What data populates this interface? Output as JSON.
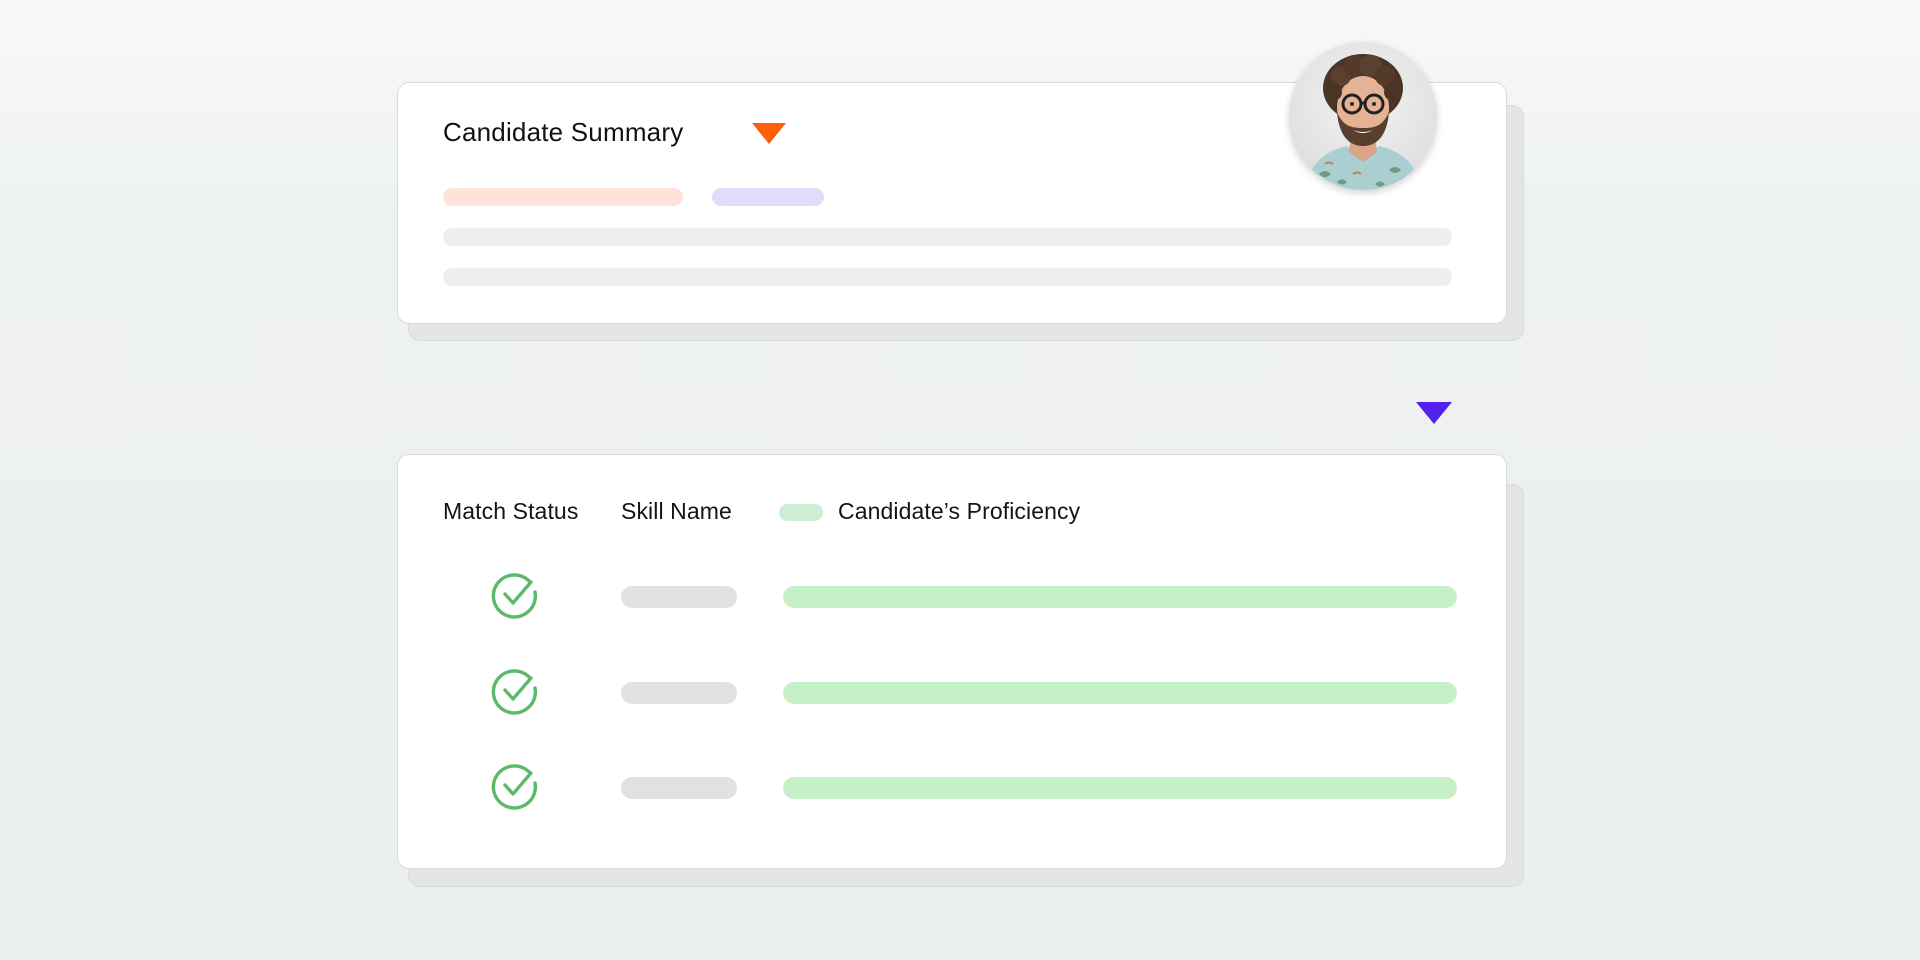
{
  "colors": {
    "summary_accent": "#ff5d0a",
    "skills_accent": "#5420ee",
    "match_check": "#5cb96a",
    "proficiency_bar": "#c6f0c8",
    "peach_tag": "#fde3d8",
    "lavender_tag": "#e2dcfb"
  },
  "summary": {
    "title": "Candidate Summary",
    "accent_icon": "triangle-down-icon",
    "avatar_icon": "candidate-photo"
  },
  "skills": {
    "marker_icon": "triangle-down-icon",
    "headers": {
      "match_status": "Match Status",
      "skill_name": "Skill Name",
      "proficiency": "Candidate’s Proficiency"
    },
    "rows": [
      {
        "match_icon": "check-circle-icon",
        "proficiency": 1.0
      },
      {
        "match_icon": "check-circle-icon",
        "proficiency": 1.0
      },
      {
        "match_icon": "check-circle-icon",
        "proficiency": 1.0
      }
    ]
  }
}
